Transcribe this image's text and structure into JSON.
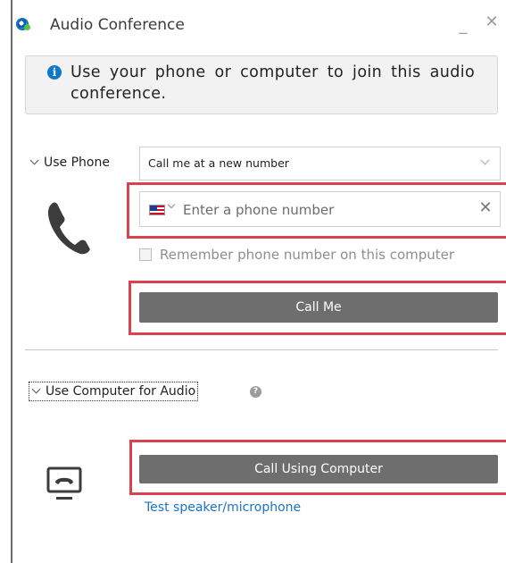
{
  "window": {
    "title": "Audio Conference",
    "minimize_glyph": "_",
    "close_glyph": "✕"
  },
  "info": {
    "icon": "info-icon",
    "icon_glyph": "i",
    "text": "Use your phone or computer to join this audio conference."
  },
  "phone_section": {
    "label": "Use Phone",
    "select_value": "Call me at a new number",
    "country_flag": "us-flag-icon",
    "phone_placeholder": "Enter a phone number",
    "phone_value": "",
    "clear_glyph": "✕",
    "remember_label": "Remember phone number on this computer",
    "remember_checked": false,
    "call_button": "Call Me"
  },
  "computer_section": {
    "label": "Use Computer for Audio",
    "help_glyph": "?",
    "call_button": "Call Using Computer",
    "test_link": "Test speaker/microphone"
  },
  "colors": {
    "highlight": "#d9434f",
    "button": "#6e6e6e",
    "link": "#1a73c8",
    "info_blue": "#0f78c9"
  }
}
